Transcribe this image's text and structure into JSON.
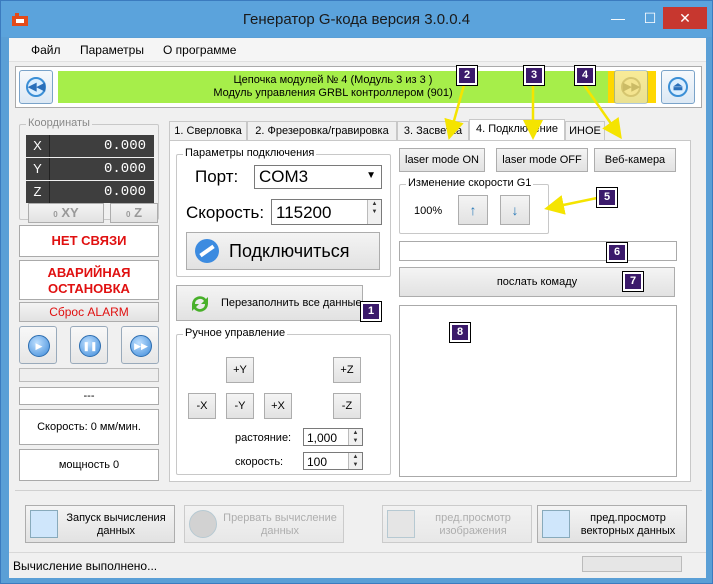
{
  "window": {
    "title": "Генератор G-кода версия 3.0.0.4",
    "minimize": "—",
    "maximize": "☐",
    "close": "✕"
  },
  "menu": {
    "items": [
      "Файл",
      "Параметры",
      "О программе"
    ]
  },
  "topbar": {
    "line1": "Цепочка модулей № 4 (Модуль 3 из 3 )",
    "line2": "Модуль управления GRBL контроллером (901)",
    "colors": {
      "panel": "#a6ee4a",
      "yellow": "#ffd700"
    }
  },
  "coords": {
    "title": "Координаты",
    "rows": [
      {
        "label": "X",
        "value": "0.000"
      },
      {
        "label": "Y",
        "value": "0.000"
      },
      {
        "label": "Z",
        "value": "0.000"
      }
    ],
    "btn_xy": "XY",
    "btn_z": "Z",
    "btn_prefix": "0"
  },
  "left": {
    "no_link": "НЕТ СВЯЗИ",
    "emergency_line1": "АВАРИЙНАЯ",
    "emergency_line2": "ОСТАНОВКА",
    "reset_alarm": "Сброс ALARM",
    "dash": "---",
    "speed": "Скорость: 0 мм/мин.",
    "power": "мощность 0"
  },
  "tabs": [
    "1. Сверловка",
    "2. Фрезеровка/гравировка",
    "3. Засветка",
    "4. Подключение",
    "ИНОЕ"
  ],
  "connection": {
    "group_title": "Параметры подключения",
    "port_label": "Порт:",
    "port_value": "COM3",
    "speed_label": "Скорость:",
    "speed_value": "115200",
    "connect": "Подключиться",
    "refill": "Перезаполнить все данные"
  },
  "manual": {
    "title": "Ручное управление",
    "py": "+Y",
    "pz": "+Z",
    "mx": "-X",
    "my": "-Y",
    "px": "+X",
    "mz": "-Z",
    "dist_label": "растояние:",
    "dist_value": "1,000",
    "speed_label": "скорость:",
    "speed_value": "100"
  },
  "right": {
    "laser_on": "laser mode ON",
    "laser_off": "laser mode OFF",
    "webcam": "Веб-камера",
    "speed_change_title": "Изменение скорости G1",
    "speed_percent": "100%",
    "command_value": "",
    "send_command": "послать комаду",
    "log_value": ""
  },
  "badges": [
    "1",
    "2",
    "3",
    "4",
    "5",
    "6",
    "7",
    "8"
  ],
  "bottom": {
    "start": "Запуск вычисления данных",
    "abort": "Прервать вычисление данных",
    "preview_image": "пред.просмотр изображения",
    "preview_vector": "пред.просмотр векторных данных"
  },
  "status": {
    "text": "Вычисление выполнено..."
  }
}
